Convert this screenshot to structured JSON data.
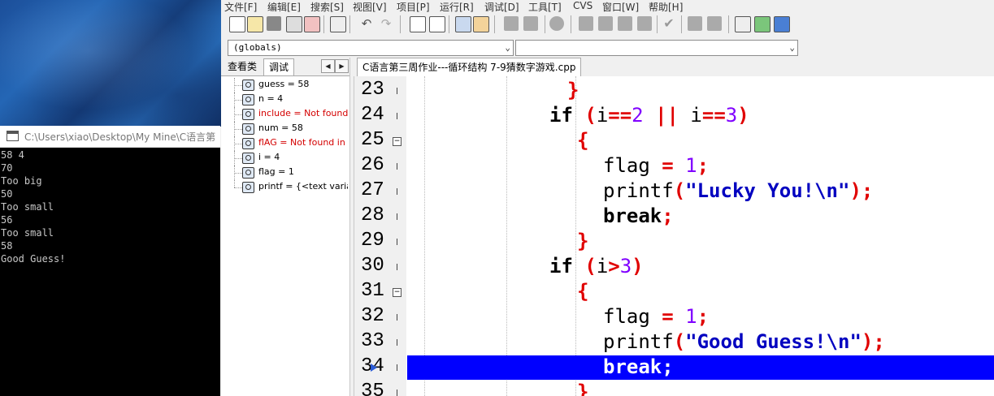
{
  "console": {
    "title": "C:\\Users\\xiao\\Desktop\\My Mine\\C语言第",
    "lines": [
      "58 4",
      "70",
      "Too big",
      "50",
      "Too small",
      "56",
      "Too small",
      "58",
      "Good Guess!"
    ]
  },
  "menu": [
    "文件[F]",
    "编辑[E]",
    "搜索[S]",
    "视图[V]",
    "项目[P]",
    "运行[R]",
    "调试[D]",
    "工具[T]",
    "CVS",
    "窗口[W]",
    "帮助[H]"
  ],
  "scope": {
    "left": "(globals)",
    "right": ""
  },
  "panel": {
    "tabs": [
      "查看类",
      "调试"
    ],
    "nav_prev": "◀",
    "nav_next": "▶",
    "watches": [
      {
        "text": "guess = 58",
        "error": false
      },
      {
        "text": "n = 4",
        "error": false
      },
      {
        "text": "include = Not found",
        "error": true
      },
      {
        "text": "num = 58",
        "error": false
      },
      {
        "text": "flAG = Not found in c",
        "error": true
      },
      {
        "text": "i = 4",
        "error": false
      },
      {
        "text": "flag = 1",
        "error": false
      },
      {
        "text": "printf = {<text variab",
        "error": false
      }
    ]
  },
  "editor": {
    "tab": "C语言第三周作业---循环结构 7-9猜数字游戏.cpp",
    "line_numbers": [
      "23",
      "24",
      "25",
      "26",
      "27",
      "28",
      "29",
      "30",
      "31",
      "32",
      "33",
      "34",
      "35"
    ],
    "current_line": "34",
    "code": {
      "l23": "}",
      "l24a": "if",
      "l24b": "(",
      "l24c": "i",
      "l24d": "==",
      "l24e": "2",
      "l24f": " || ",
      "l24g": "i",
      "l24h": "==",
      "l24i": "3",
      "l24j": ")",
      "l25": "{",
      "l26a": "flag ",
      "l26b": "=",
      "l26c": " 1",
      "l26d": ";",
      "l27a": "printf",
      "l27b": "(",
      "l27c": "\"Lucky You!\\n\"",
      "l27d": ");",
      "l28a": "break",
      "l28b": ";",
      "l29": "}",
      "l30a": "if",
      "l30b": "(",
      "l30c": "i",
      "l30d": ">",
      "l30e": "3",
      "l30f": ")",
      "l31": "{",
      "l32a": "flag ",
      "l32b": "=",
      "l32c": " 1",
      "l32d": ";",
      "l33a": "printf",
      "l33b": "(",
      "l33c": "\"Good Guess!\\n\"",
      "l33d": ");",
      "l34": "break;",
      "l35": "}"
    }
  },
  "colors": {
    "keyword": "#000000",
    "operator": "#e00000",
    "number": "#8000ff",
    "string": "#0000c0",
    "highlight": "#0000ff"
  }
}
